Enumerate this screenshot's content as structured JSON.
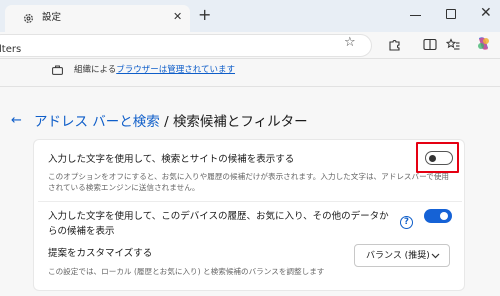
{
  "browser": {
    "tab_title": "設定",
    "close_glyph": "✕",
    "new_tab_glyph": "+",
    "window_close_glyph": "✕",
    "address_partial": "lters",
    "star_glyph": "☆"
  },
  "managed_bar": {
    "prefix": "組織による",
    "link": "ブラウザーは管理されています"
  },
  "breadcrumb": {
    "back_glyph": "←",
    "parent": "アドレス バーと検索",
    "separator": " / ",
    "current": "検索候補とフィルター"
  },
  "settings": [
    {
      "title": "入力した文字を使用して、検索とサイトの候補を表示する",
      "description": "このオプションをオフにすると、お気に入りや履歴の候補だけが表示されます。入力した文字は、アドレスバーで使用されている検索エンジンに送信されません。",
      "enabled": false
    },
    {
      "title": "入力した文字を使用して、このデバイスの履歴、お気に入り、その他のデータからの候補を表示",
      "help_glyph": "?",
      "enabled": true
    },
    {
      "title": "提案をカスタマイズする",
      "description": "この設定では、ローカル (履歴とお気に入り) と検索候補のバランスを調整します",
      "selected_value": "バランス (推奨)"
    }
  ],
  "colors": {
    "accent": "#0f5ec9",
    "toggle_on": "#1562d6",
    "highlight_box": "#e50012"
  }
}
